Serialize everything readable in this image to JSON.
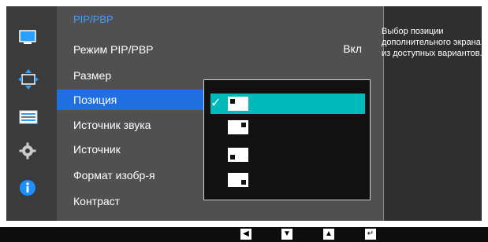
{
  "menu": {
    "title": "PIP/PBP",
    "items": [
      {
        "label": "Режим PIP/PBP",
        "value": "Вкл"
      },
      {
        "label": "Размер"
      },
      {
        "label": "Позиция"
      },
      {
        "label": "Источник звука"
      },
      {
        "label": "Источник"
      },
      {
        "label": "Формат изобр-я"
      },
      {
        "label": "Контраст"
      }
    ],
    "selected_index": 2
  },
  "help": {
    "text": "Выбор позиции дополнительного экрана из доступных вариантов."
  },
  "left_icons": [
    "monitor-icon",
    "move-arrows-icon",
    "pip-settings-icon",
    "gear-icon",
    "info-icon"
  ],
  "submenu": {
    "options": [
      "top-left",
      "top-right",
      "bottom-left",
      "bottom-right"
    ],
    "selected": "top-left",
    "check": "✓"
  },
  "bottom_bar": {
    "buttons": [
      "left-arrow-icon",
      "down-arrow-icon",
      "up-arrow-icon",
      "enter-icon"
    ],
    "glyphs": [
      "◀",
      "▼",
      "▲",
      "↵"
    ]
  },
  "colors": {
    "accent_blue": "#1f6fe0",
    "title_blue": "#3fa0ff",
    "teal_highlight": "#00b9b9"
  }
}
